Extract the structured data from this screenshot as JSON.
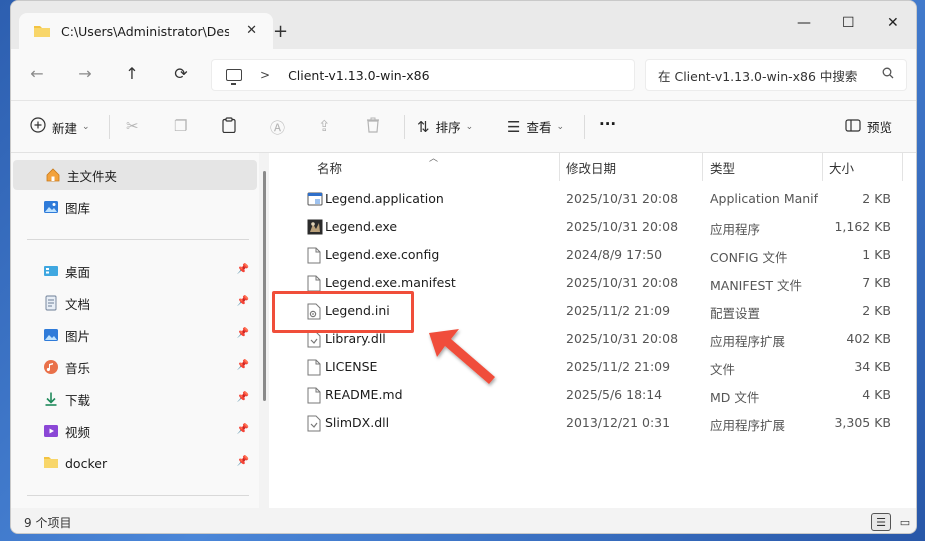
{
  "window": {
    "tab_title": "C:\\Users\\Administrator\\Desktop",
    "tab_close": "✕",
    "new_tab": "+",
    "minimize": "—",
    "maximize": "☐",
    "close": "✕"
  },
  "nav": {
    "back": "←",
    "forward": "→",
    "up": "↑",
    "refresh": "⟳",
    "crumb_sep": ">",
    "breadcrumb": "Client-v1.13.0-win-x86",
    "search_placeholder": "在 Client-v1.13.0-win-x86 中搜索"
  },
  "toolbar": {
    "new_label": "新建",
    "sort_label": "排序",
    "view_label": "查看",
    "more_label": "···",
    "preview_label": "预览"
  },
  "sidebar": {
    "items": [
      {
        "label": "主文件夹",
        "icon": "home-icon"
      },
      {
        "label": "图库",
        "icon": "gallery-icon"
      },
      {
        "label": "桌面",
        "icon": "desktop-icon"
      },
      {
        "label": "文档",
        "icon": "documents-icon"
      },
      {
        "label": "图片",
        "icon": "pictures-icon"
      },
      {
        "label": "音乐",
        "icon": "music-icon"
      },
      {
        "label": "下载",
        "icon": "downloads-icon"
      },
      {
        "label": "视频",
        "icon": "videos-icon"
      },
      {
        "label": "docker",
        "icon": "folder-icon"
      }
    ]
  },
  "columns": {
    "name": "名称",
    "date": "修改日期",
    "type": "类型",
    "size": "大小"
  },
  "files": [
    {
      "name": "Legend.application",
      "date": "2025/10/31 20:08",
      "type": "Application Manifest",
      "size": "2 KB",
      "icon": "application-icon"
    },
    {
      "name": "Legend.exe",
      "date": "2025/10/31 20:08",
      "type": "应用程序",
      "size": "1,162 KB",
      "icon": "exe-icon"
    },
    {
      "name": "Legend.exe.config",
      "date": "2024/8/9 17:50",
      "type": "CONFIG 文件",
      "size": "1 KB",
      "icon": "file-icon"
    },
    {
      "name": "Legend.exe.manifest",
      "date": "2025/10/31 20:08",
      "type": "MANIFEST 文件",
      "size": "7 KB",
      "icon": "file-icon"
    },
    {
      "name": "Legend.ini",
      "date": "2025/11/2 21:09",
      "type": "配置设置",
      "size": "2 KB",
      "icon": "ini-icon"
    },
    {
      "name": "Library.dll",
      "date": "2025/10/31 20:08",
      "type": "应用程序扩展",
      "size": "402 KB",
      "icon": "dll-icon"
    },
    {
      "name": "LICENSE",
      "date": "2025/11/2 21:09",
      "type": "文件",
      "size": "34 KB",
      "icon": "file-icon"
    },
    {
      "name": "README.md",
      "date": "2025/5/6 18:14",
      "type": "MD 文件",
      "size": "4 KB",
      "icon": "file-icon"
    },
    {
      "name": "SlimDX.dll",
      "date": "2013/12/21 0:31",
      "type": "应用程序扩展",
      "size": "3,305 KB",
      "icon": "dll-icon"
    }
  ],
  "status": {
    "count": "9 个项目"
  },
  "colors": {
    "highlight": "#f04e3a",
    "selected": "#e5e5e5"
  }
}
